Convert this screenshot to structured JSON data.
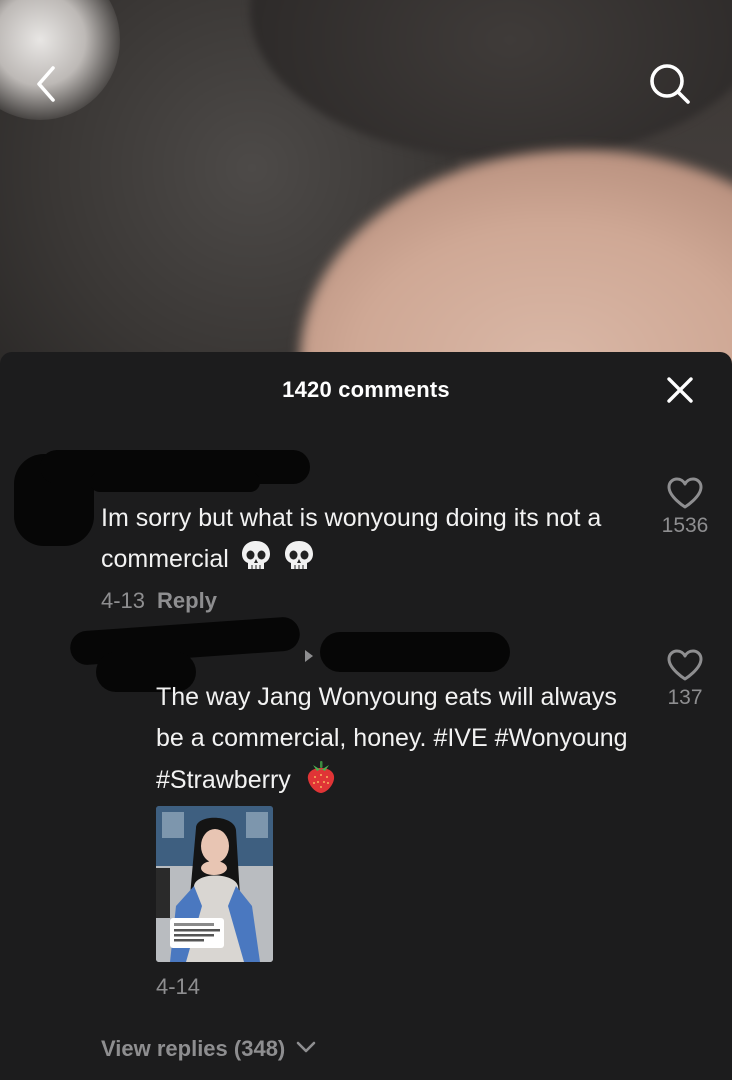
{
  "panel": {
    "title": "1420 comments"
  },
  "comments": [
    {
      "text": "Im sorry but what is wonyoung doing its not a commercial",
      "emoji": "💀💀",
      "date": "4-13",
      "reply_label": "Reply",
      "likes": "1536"
    }
  ],
  "replies": [
    {
      "text": "The way Jang Wonyoung eats will always be a commercial, honey. #IVE #Wonyoung #Strawberry",
      "emoji": "🍓",
      "date": "4-14",
      "likes": "137"
    }
  ],
  "view_replies": {
    "label": "View replies (348)"
  },
  "icons": {
    "back": "chevron-left-icon",
    "search": "search-icon",
    "close": "close-icon",
    "like": "heart-outline-icon",
    "view_replies": "chevron-down-icon"
  },
  "colors": {
    "panel_bg": "#1c1c1d",
    "primary_text": "#f2f2f2",
    "secondary_text": "#8e8e90",
    "redaction": "#060606"
  }
}
